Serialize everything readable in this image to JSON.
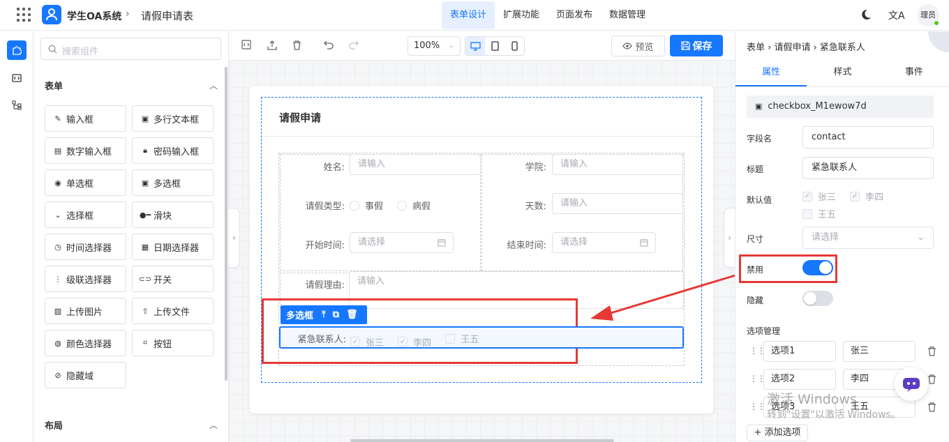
{
  "header": {
    "app_title": "学生OA系统",
    "separator": "›",
    "page_name": "请假申请表",
    "nav": [
      "表单设计",
      "扩展功能",
      "页面发布",
      "数据管理"
    ],
    "nav_active": "表单设计",
    "avatar_text": "理员",
    "translate_icon": "文A"
  },
  "component_panel": {
    "search_placeholder": "搜索组件",
    "sections": [
      {
        "title": "表单",
        "items": [
          "输入框",
          "多行文本框",
          "数字输入框",
          "密码输入框",
          "单选框",
          "多选框",
          "选择框",
          "滑块",
          "时间选择器",
          "日期选择器",
          "级联选择器",
          "开关",
          "上传图片",
          "上传文件",
          "颜色选择器",
          "按钮",
          "隐藏域"
        ]
      },
      {
        "title": "布局"
      }
    ]
  },
  "toolbar": {
    "zoom": "100%",
    "preview_label": "预览",
    "save_label": "保存"
  },
  "form": {
    "title": "请假申请",
    "fields": {
      "name_label": "姓名:",
      "name_placeholder": "请输入",
      "college_label": "学院:",
      "college_placeholder": "请输入",
      "type_label": "请假类型:",
      "type_options": [
        "事假",
        "病假"
      ],
      "days_label": "天数:",
      "days_placeholder": "请输入",
      "start_label": "开始时间:",
      "start_placeholder": "请选择",
      "end_label": "结束时间:",
      "end_placeholder": "请选择",
      "reason_label": "请假理由:",
      "reason_placeholder": "请输入",
      "contact_label": "紧急联系人:",
      "contact_options": [
        {
          "label": "张三",
          "checked": true
        },
        {
          "label": "李四",
          "checked": true
        },
        {
          "label": "王五",
          "checked": false
        }
      ]
    },
    "selected_tag": "多选框"
  },
  "props_panel": {
    "breadcrumb": "表单 › 请假申请 › 紧急联系人",
    "tabs": [
      "属性",
      "样式",
      "事件"
    ],
    "active_tab": "属性",
    "component_id": "checkbox_M1ewow7d",
    "field_name_label": "字段名",
    "field_name_value": "contact",
    "title_label": "标题",
    "title_value": "紧急联系人",
    "default_label": "默认值",
    "default_options": [
      {
        "label": "张三",
        "checked": true
      },
      {
        "label": "李四",
        "checked": true
      },
      {
        "label": "王五",
        "checked": false
      }
    ],
    "size_label": "尺寸",
    "size_placeholder": "请选择",
    "disabled_label": "禁用",
    "disabled": true,
    "hidden_label": "隐藏",
    "hidden": false,
    "options_title": "选项管理",
    "options": [
      {
        "key": "选项1",
        "value": "张三"
      },
      {
        "key": "选项2",
        "value": "李四"
      },
      {
        "key": "选项3",
        "value": "王五"
      }
    ],
    "add_option_label": "+ 添加选项"
  },
  "watermark": {
    "line1": "激活 Windows",
    "line2": "转到\"设置\"以激活 Windows。"
  },
  "colors": {
    "accent": "#1677ff",
    "highlight": "#e53935"
  }
}
